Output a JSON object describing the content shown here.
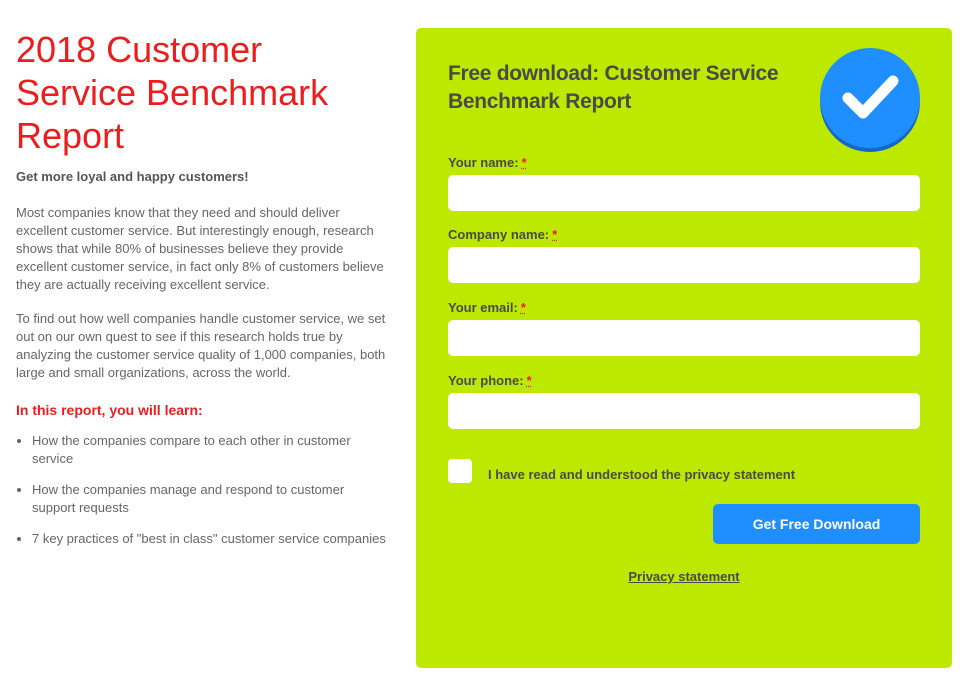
{
  "left": {
    "title": "2018 Customer Service Benchmark Report",
    "subtitle": "Get more loyal and happy customers!",
    "paragraph1": "Most companies know that they need and should deliver excellent customer service. But interestingly enough, research shows that while 80% of businesses believe they provide excellent customer service, in fact only 8% of customers believe they are actually receiving excellent service.",
    "paragraph2": "To find out how well companies handle customer service, we set out on our own quest to see if this research holds true by analyzing the customer service quality of 1,000 companies, both large and small organizations, across the world.",
    "learn_heading": "In this report, you will learn:",
    "learn_items": [
      "How the companies compare to each other in customer service",
      "How the companies manage and respond to customer support requests",
      "7 key practices of \"best in class\" customer service companies"
    ]
  },
  "form": {
    "title": "Free download: Customer Service Benchmark Report",
    "badge_icon": "checkmark-icon",
    "fields": [
      {
        "label": "Your name:",
        "required_mark": "*",
        "value": "",
        "placeholder": ""
      },
      {
        "label": "Company name:",
        "required_mark": "*",
        "value": "",
        "placeholder": ""
      },
      {
        "label": "Your email:",
        "required_mark": "*",
        "value": "",
        "placeholder": ""
      },
      {
        "label": "Your phone:",
        "required_mark": "*",
        "value": "",
        "placeholder": ""
      }
    ],
    "privacy_checkbox_label": "I have read and understood the privacy statement",
    "submit_label": "Get Free Download",
    "privacy_link": "Privacy statement"
  },
  "colors": {
    "accent_red": "#ee1d1d",
    "panel_green": "#bde900",
    "button_blue": "#1f8fff"
  }
}
